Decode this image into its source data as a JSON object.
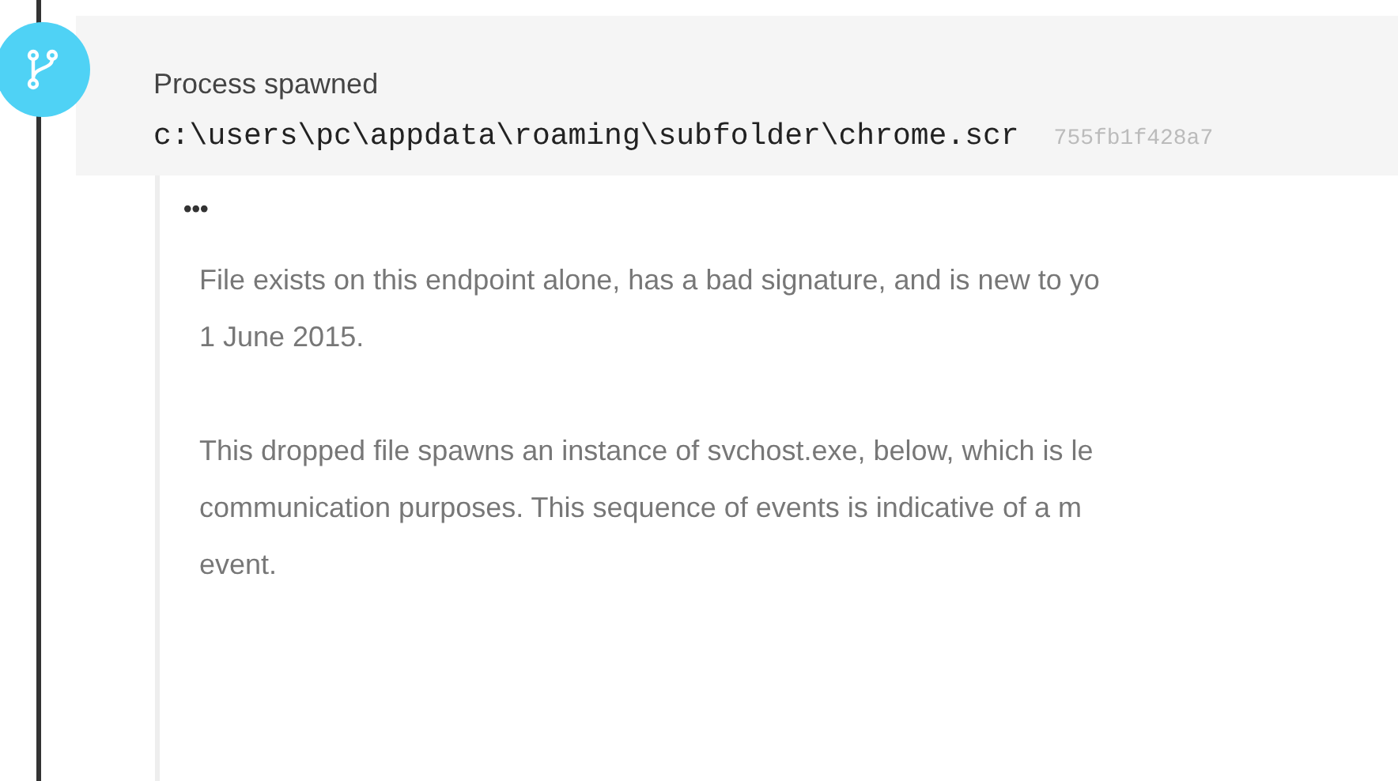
{
  "event": {
    "title": "Process spawned",
    "path": "c:\\users\\pc\\appdata\\roaming\\subfolder\\chrome.scr",
    "hash": "755fb1f428a7"
  },
  "details": {
    "menu": "•••",
    "paragraphs": [
      [
        "File exists on this endpoint alone, has a bad signature, and is new to yo",
        "1 June 2015."
      ],
      [
        "This dropped file spawns an instance of svchost.exe, below, which is le",
        "communication purposes. This sequence of events is indicative of a m",
        "event."
      ]
    ]
  }
}
